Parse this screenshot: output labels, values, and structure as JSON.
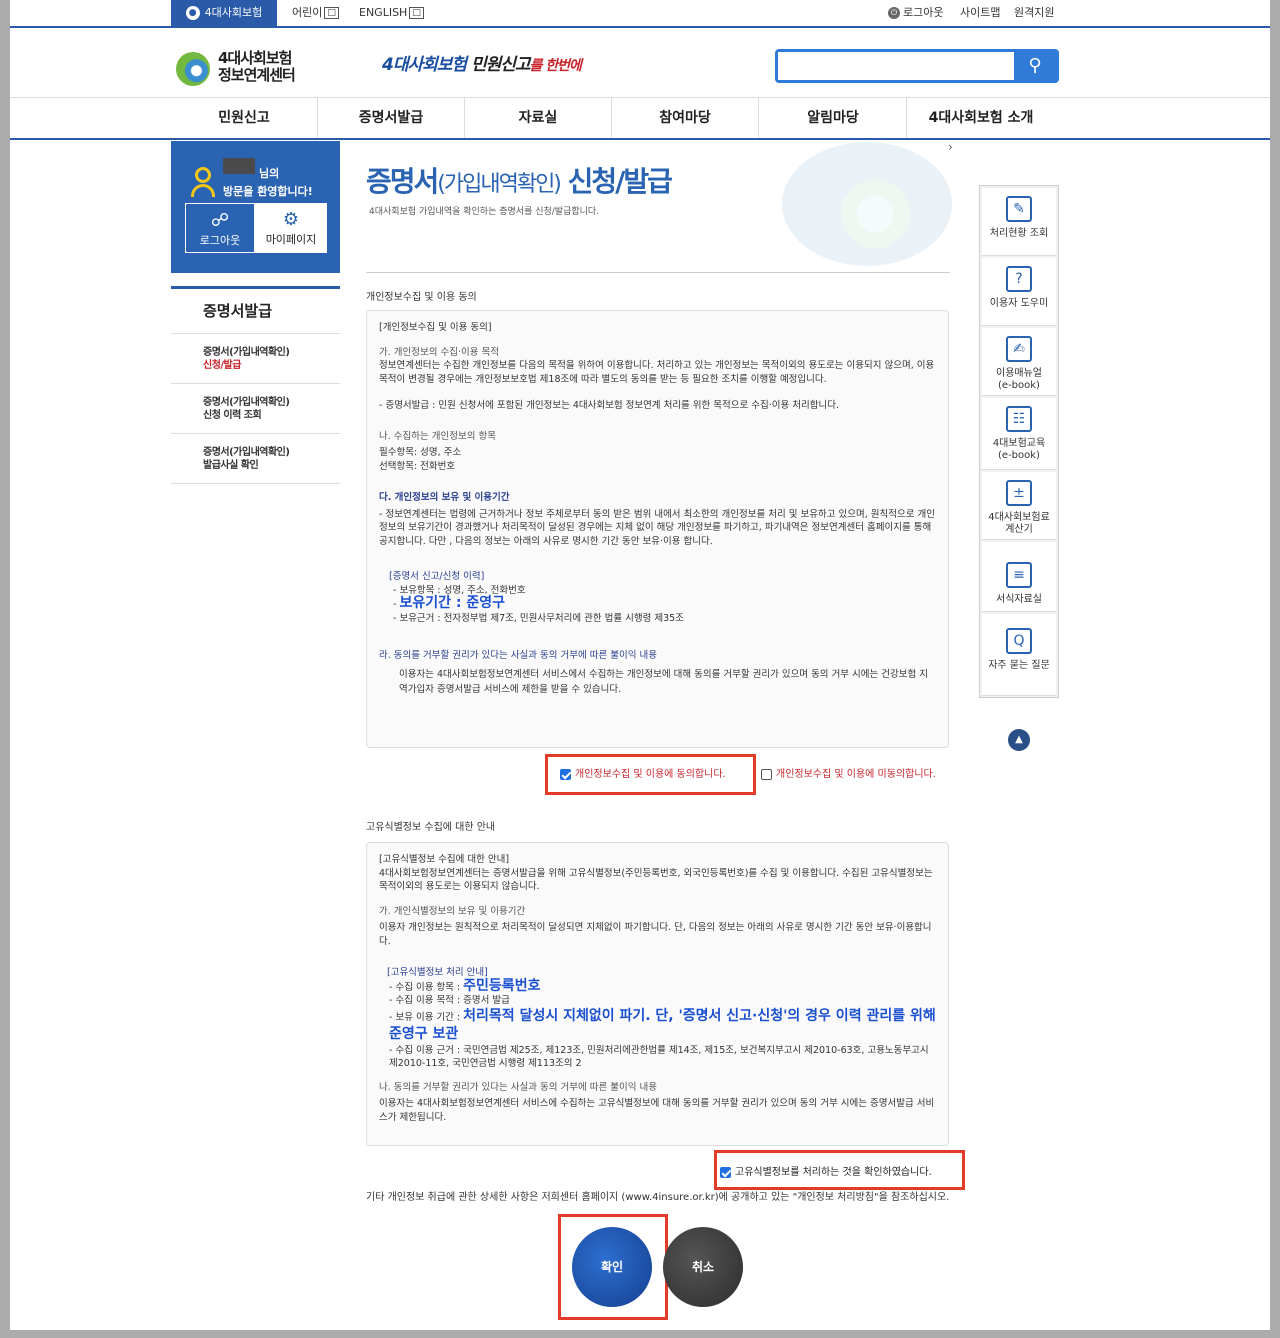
{
  "topbar": {
    "active_tab": "4대사회보험",
    "links": [
      "어린이",
      "ENGLISH"
    ],
    "logout": "로그아웃",
    "sitemap": "사이트맵",
    "remote": "원격지원"
  },
  "header": {
    "logo_line1": "4대사회보험",
    "logo_line2": "정보연계센터",
    "slogan_part1": "4대사회보험",
    "slogan_part2": "민원신고",
    "slogan_part3": "를 한번에",
    "search_placeholder": ""
  },
  "gnb": [
    "민원신고",
    "증명서발급",
    "자료실",
    "참여마당",
    "알림마당",
    "4대사회보험 소개"
  ],
  "user": {
    "suffix": "님의",
    "welcome": "방문을 환영합니다!",
    "logout_label": "로그아웃",
    "mypage_label": "마이페이지"
  },
  "lnb": {
    "title": "증명서발급",
    "items": [
      {
        "line1": "증명서(가입내역확인)",
        "line2": "신청/발급"
      },
      {
        "line1": "증명서(가입내역확인)",
        "line2": "신청 이력 조회"
      },
      {
        "line1": "증명서(가입내역확인)",
        "line2": "발급사실 확인"
      }
    ]
  },
  "page": {
    "title_main": "증명서",
    "title_sub": "(가입내역확인)",
    "title_tail": " 신청/발급",
    "desc": "4대사회보험 가입내역을 확인하는 증명서를 신청/발급합니다.",
    "chevron": "›"
  },
  "privacy": {
    "section_label": "개인정보수집 및 이용 동의",
    "box_title": "[개인정보수집 및 이용 동의]",
    "a_title": "가. 개인정보의 수집·이용 목적",
    "a_body": "정보연계센터는 수집한 개인정보를 다음의 목적을 위하여 이용합니다. 처리하고 있는 개인정보는 목적이외의 용도로는 이용되지 않으며, 이용 목적이 변경될 경우에는 개인정보보호법 제18조에 따라 별도의 동의를 받는 등 필요한 조치를 이행할 예정입니다.",
    "a_item": "- 증명서발급 : 민원 신청서에 포함된 개인정보는 4대사회보험 정보연계 처리를 위한 목적으로 수집·이용 처리합니다.",
    "b_title": "나. 수집하는 개인정보의 항목",
    "b_required": "필수항목: 성명, 주소",
    "b_optional": "선택항목: 전화번호",
    "c_title": "다. 개인정보의 보유 및 이용기간",
    "c_body": "- 정보연계센터는 법령에 근거하거나 정보 주체로부터 동의 받은 범위 내에서 최소한의 개인정보를 처리 및 보유하고 있으며, 원칙적으로 개인정보의 보유기간이 경과했거나 처리목적이 달성된 경우에는 지체 없이 해당 개인정보를 파기하고, 파기내역은 정보연계센터 홈페이지를 통해 공지합니다. 다만 , 다음의 정보는 아래의 사유로 명시한 기간 동안 보유·이용 합니다.",
    "c_sub_title": "[증명서 신고/신청 이력]",
    "c_item1": "- 보유항목 : 성명, 주소, 전화번호",
    "c_item2_prefix": "- ",
    "c_item2": "보유기간 : 준영구",
    "c_item3": "- 보유근거 : 전자정부법 제7조, 민원사무처리에 관한 법률 시행령 제35조",
    "d_title": "라. 동의를 거부할 권리가 있다는 사실과 동의 거부에 따른 불이익 내용",
    "d_body": "이용자는 4대사회보험정보연계센터 서비스에서 수집하는 개인정보에 대해 동의를 거부할 권리가 있으며 동의 거부 시에는 건강보험 지역가입자 증명서발급 서비스에 제한을 받을 수 있습니다.",
    "agree_label": "개인정보수집 및 이용에 동의합니다.",
    "disagree_label": "개인정보수집 및 이용에 미동의합니다."
  },
  "unique": {
    "section_label": "고유식별정보 수집에 대한 안내",
    "box_title": "[고유식별정보 수집에 대한 안내]",
    "intro": "4대사회보험정보연계센터는 증명서발급을 위해 고유식별정보(주민등록번호, 외국인등록번호)를 수집 및 이용합니다. 수집된 고유식별정보는 목적이외의 용도로는 이용되지 않습니다.",
    "a_title": "가. 개인식별정보의 보유 및 이용기간",
    "a_body": "이용자 개인정보는 원칙적으로 처리목적이 달성되면 지체없이 파기합니다. 단, 다음의 정보는 아래의 사유로 명시한 기간 동안 보유·이용합니다.",
    "sub_title": "[고유식별정보 처리 안내]",
    "item1_prefix": "- 수집 이용 항목 : ",
    "item1_big": "주민등록번호",
    "item2": "- 수집 이용 목적 : 증명서 발급",
    "item3_prefix": "- 보유 이용 기간 : ",
    "item3_big": "처리목적 달성시 지체없이 파기. 단, '증명서 신고·신청'의 경우 이력 관리를 위해 준영구 보관",
    "item4": "- 수집 이용 근거 : 국민연금법 제25조, 제123조, 민원처리에관한법률 제14조, 제15조, 보건복지부고시 제2010-63호, 고용노동부고시 제2010-11호, 국민연금법 시행령 제113조의 2",
    "b_title": "나. 동의를 거부할 권리가 있다는 사실과 동의 거부에 따른 불이익 내용",
    "b_body": "이용자는 4대사회보험정보연계센터 서비스에 수집하는 고유식별정보에 대해 동의를 거부할 권리가 있으며 동의 거부 시에는 증명서발급 서비스가 제한됩니다.",
    "confirm_label": "고유식별정보를 처리하는 것을 확인하였습니다."
  },
  "footnote": "기타 개인정보 취급에 관한 상세한 사항은 저희센터 홈페이지 (www.4insure.or.kr)에 공개하고 있는 \"개인정보 처리방침\"을 참조하십시오.",
  "buttons": {
    "ok": "확인",
    "cancel": "취소"
  },
  "quick": [
    {
      "label1": "처리현황 조회",
      "label2": "",
      "icon": "clipboard-icon"
    },
    {
      "label1": "이용자 도우미",
      "label2": "",
      "icon": "monitor-help-icon"
    },
    {
      "label1": "이용매뉴얼",
      "label2": "(e-book)",
      "icon": "manual-icon"
    },
    {
      "label1": "4대보험교육",
      "label2": "(e-book)",
      "icon": "book-icon"
    },
    {
      "label1": "4대사회보험료",
      "label2": "계산기",
      "icon": "calculator-icon"
    },
    {
      "label1": "서식자료실",
      "label2": "",
      "icon": "document-icon"
    },
    {
      "label1": "자주 묻는 질문",
      "label2": "",
      "icon": "faq-icon"
    }
  ],
  "colors": {
    "brand": "#2a63b2",
    "accent": "#1f6fe0",
    "highlight_frame": "#e23c28"
  }
}
